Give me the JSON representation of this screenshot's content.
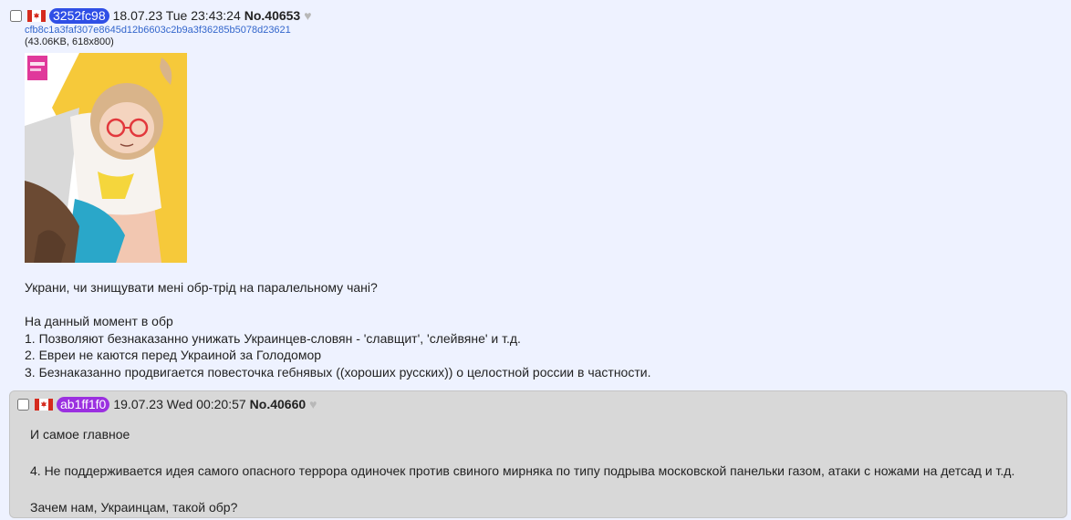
{
  "op": {
    "id": "3252fc98",
    "id_color": "#2f4fe6",
    "date": "18.07.23 Tue 23:43:24",
    "post_no": "No.40653",
    "heart": "♥",
    "file": {
      "name": "cfb8c1a3faf307e8645d12b6603c2b9a3f36285b5078d23621",
      "info": "(43.06KB, 618x800)"
    },
    "body": [
      "Украни, чи знищувати мені обр-трід на паралельному чані?",
      "",
      "На данный момент в обр",
      "1. Позволяют безнаказанно унижать Украинцев-словян - 'славщит', 'слейвяне' и т.д.",
      "2. Евреи не каются перед Украиной за Голодомор",
      "3. Безнаказанно продвигается повесточка гебнявых ((хороших русских)) о целостной россии в частности."
    ]
  },
  "reply": {
    "id": "ab1ff1f0",
    "id_color": "#9b30e0",
    "date": "19.07.23 Wed 00:20:57",
    "post_no": "No.40660",
    "heart": "♥",
    "body": [
      "И самое главное",
      "",
      "4. Не поддерживается идея самого опасного террора одиночек против свиного мирняка по типу подрыва московской панельки газом, атаки с ножами на детсад и т.д.",
      "",
      "Зачем нам, Украинцам, такой обр?"
    ]
  }
}
